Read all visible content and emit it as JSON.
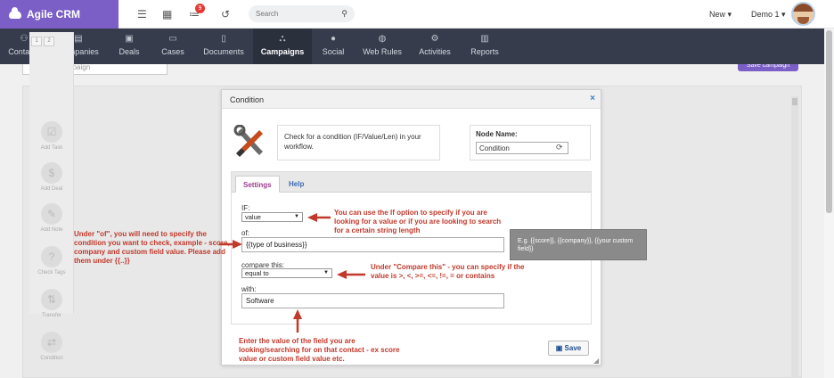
{
  "header": {
    "brand": "Agile CRM",
    "notification_count": "9",
    "search_placeholder": "Search",
    "new_menu": "New ▾",
    "user_menu": "Demo 1 ▾"
  },
  "nav": {
    "items": [
      {
        "label": "Contacts",
        "icon": "person-icon"
      },
      {
        "label": "Companies",
        "icon": "building-icon"
      },
      {
        "label": "Deals",
        "icon": "money-icon"
      },
      {
        "label": "Cases",
        "icon": "folder-icon"
      },
      {
        "label": "Documents",
        "icon": "document-icon"
      },
      {
        "label": "Campaigns",
        "icon": "sitemap-icon"
      },
      {
        "label": "Social",
        "icon": "chat-icon"
      },
      {
        "label": "Web Rules",
        "icon": "globe-icon"
      },
      {
        "label": "Activities",
        "icon": "gears-icon"
      },
      {
        "label": "Reports",
        "icon": "bar-chart-icon"
      }
    ],
    "active": "Campaigns"
  },
  "campaign": {
    "name_placeholder": "Name of campaign",
    "save_label": "Save campaign"
  },
  "palette": {
    "tabs": [
      "1",
      "2"
    ],
    "items": [
      "Add Task",
      "Add Deal",
      "Add Note",
      "Check Tags",
      "Transfer",
      "Condition"
    ]
  },
  "modal": {
    "title": "Condition",
    "close": "×",
    "description": "Check for a condition (IF/Value/Len) in your workflow.",
    "node_name_label": "Node Name:",
    "node_name_value": "Condition",
    "tabs": {
      "settings": "Settings",
      "help": "Help"
    },
    "form": {
      "if_label": "IF:",
      "if_value": "value",
      "of_label": "of:",
      "of_value": "{{type of business}}",
      "compare_label": "compare this:",
      "compare_value": "equal to",
      "with_label": "with:",
      "with_value": "Software"
    },
    "tooltip": "E.g. {{score}}, {{company}}, {{your custom field}}",
    "save_label": "Save"
  },
  "annotations": {
    "if_note": "You can use the If option to specify if you are looking for a value or if you are looking to search for a certain string length",
    "of_note": "Under \"of\", you will need to specify the condition you want to check, example - score, company and custom field value. Please add them under {{..}}",
    "compare_note": "Under \"Compare this\" - you can specify if the value is >, <, >=, <=, !=, = or contains",
    "with_note": "Enter the value of the field you are looking/searching for on that contact - ex score value or custom field value etc."
  },
  "colors": {
    "brand": "#7b5fc7",
    "navbar": "#363c4c",
    "annotation": "#c0392b",
    "tab_active": "#9c3c8e"
  }
}
